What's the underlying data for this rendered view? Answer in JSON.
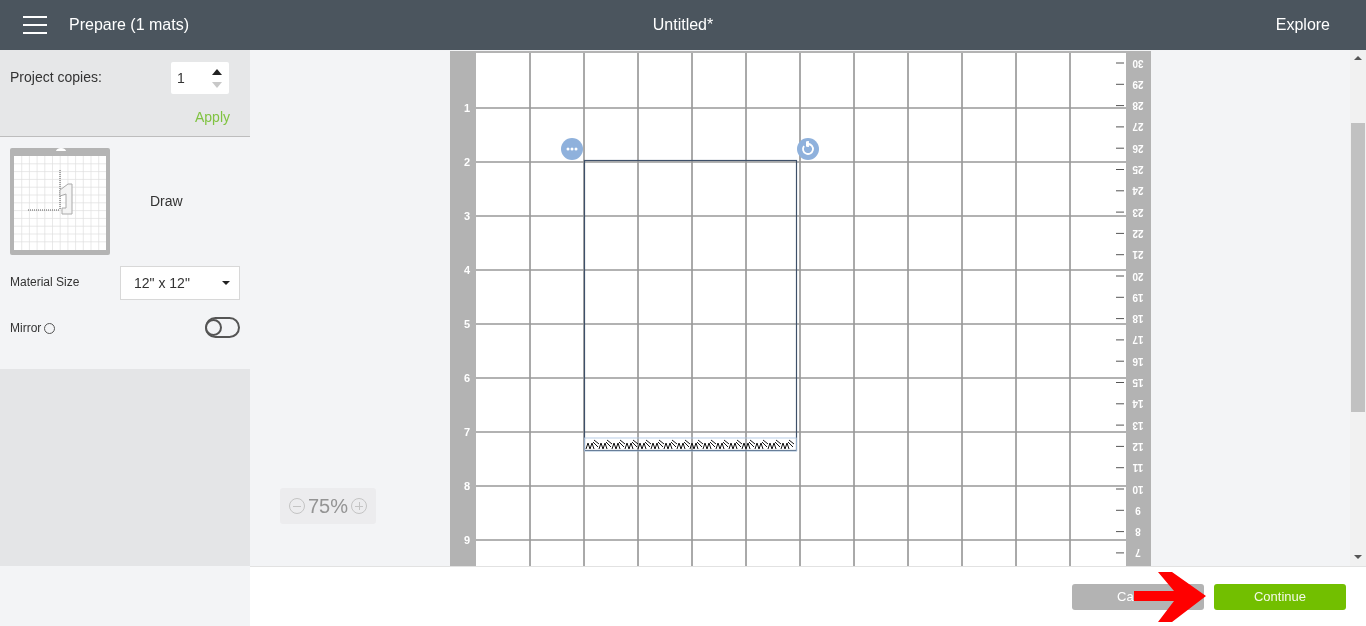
{
  "header": {
    "title": "Prepare (1 mats)",
    "document_title": "Untitled*",
    "explore": "Explore"
  },
  "copies": {
    "label": "Project copies:",
    "value": "1",
    "apply": "Apply"
  },
  "mat_card": {
    "label": "Draw"
  },
  "material_size": {
    "label": "Material Size",
    "value": "12\" x 12\""
  },
  "mirror": {
    "label": "Mirror",
    "on": false
  },
  "zoom": {
    "value": "75%"
  },
  "mat": {
    "left_ruler": [
      "1",
      "2",
      "3",
      "4",
      "5",
      "6",
      "7",
      "8",
      "9"
    ],
    "right_ruler": [
      "30",
      "29",
      "28",
      "27",
      "26",
      "25",
      "24",
      "23",
      "22",
      "21",
      "20",
      "19",
      "18",
      "17",
      "16",
      "15",
      "14",
      "13",
      "12",
      "11",
      "10",
      "9",
      "8",
      "7"
    ]
  },
  "buttons": [
    {
      "label": "Ca",
      "kind": "cancel"
    },
    {
      "label": "Continue",
      "kind": "continue"
    }
  ]
}
